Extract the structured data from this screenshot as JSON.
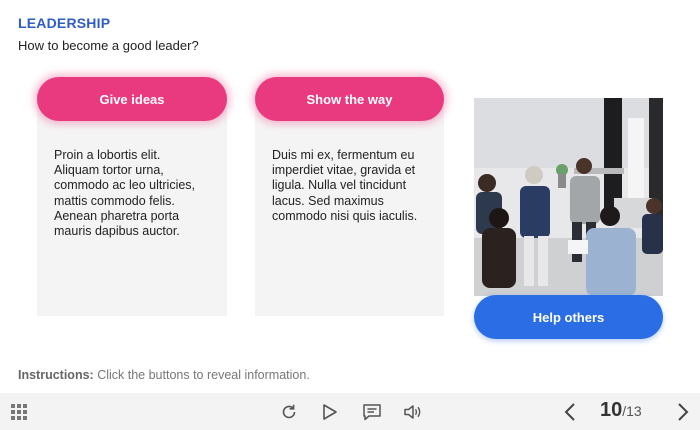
{
  "header": {
    "kicker": "LEADERSHIP",
    "title": "How to become a good leader?"
  },
  "cards": [
    {
      "button": "Give ideas",
      "text": "Proin a lobortis elit.\nAliquam tortor urna,\ncommodo ac leo ultricies,\nmattis commodo felis.\nAenean pharetra porta\nmauris dapibus auctor."
    },
    {
      "button": "Show the way",
      "text": "Duis mi ex, fermentum eu\nimperdiet vitae, gravida et\nligula. Nulla vel tincidunt\nlacus. Sed maximus\ncommodo nisi quis iaculis."
    },
    {
      "button": "Help others"
    }
  ],
  "instructions": {
    "label": "Instructions:",
    "text": "Click the buttons to reveal information."
  },
  "toolbar": {
    "icons": [
      "menu-grid-icon",
      "reload-icon",
      "play-icon",
      "caption-icon",
      "volume-icon",
      "chevron-left-icon",
      "chevron-right-icon"
    ],
    "page_current": "10",
    "page_separator": "/",
    "page_total": "13"
  },
  "colors": {
    "kicker": "#2e5ec4",
    "pink_button": "#ea3a7f",
    "blue_button": "#2a6de4",
    "card_bg": "#f4f4f4",
    "toolbar_bg": "#f3f3f3"
  }
}
